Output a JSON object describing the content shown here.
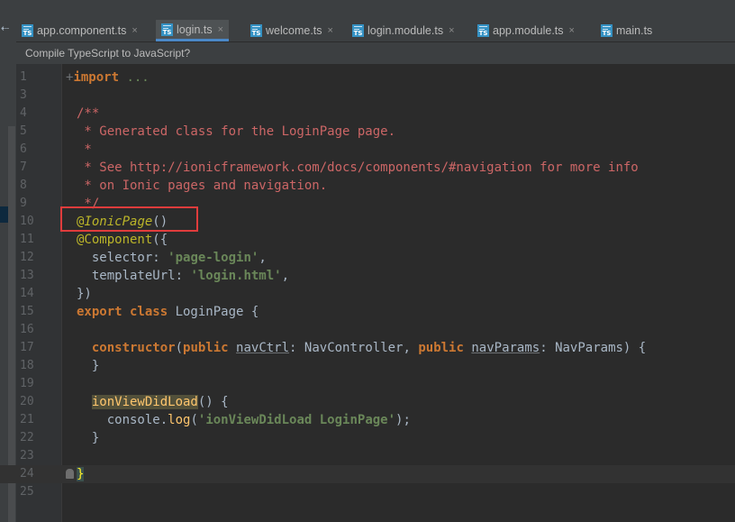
{
  "window": {
    "left_arrow": "⇠"
  },
  "tabs": [
    {
      "label": "app.component.ts",
      "active": false
    },
    {
      "label": "login.ts",
      "active": true
    },
    {
      "label": "welcome.ts",
      "active": false
    },
    {
      "label": "login.module.ts",
      "active": false
    },
    {
      "label": "app.module.ts",
      "active": false
    },
    {
      "label": "main.ts",
      "active": false
    }
  ],
  "breadcrumb": "Compile TypeScript to JavaScript?",
  "colors": {
    "editor_bg": "#2b2b2b",
    "keyword": "#cc7832",
    "string": "#6a8759",
    "comment": "#cc6666",
    "annotation": "#bbb529",
    "highlight_box": "#e03c3c"
  },
  "icons": {
    "file": "ts-file-icon",
    "close": "×"
  },
  "editor": {
    "lines": [
      {
        "n": "1",
        "segments": [
          [
            "plus",
            "+"
          ],
          [
            "kw",
            "import"
          ],
          [
            "punc",
            " "
          ],
          [
            "fold",
            "..."
          ]
        ]
      },
      {
        "n": "3",
        "segments": []
      },
      {
        "n": "4",
        "segments": [
          [
            "cm",
            "/**"
          ]
        ]
      },
      {
        "n": "5",
        "segments": [
          [
            "cm",
            " * Generated class for the LoginPage page."
          ]
        ]
      },
      {
        "n": "6",
        "segments": [
          [
            "cm",
            " *"
          ]
        ]
      },
      {
        "n": "7",
        "segments": [
          [
            "cm",
            " * See http://ionicframework.com/docs/components/#navigation for more info"
          ]
        ]
      },
      {
        "n": "8",
        "segments": [
          [
            "cm",
            " * on Ionic pages and navigation."
          ]
        ]
      },
      {
        "n": "9",
        "segments": [
          [
            "cm",
            " */"
          ]
        ]
      },
      {
        "n": "10",
        "segments": [
          [
            "ann",
            "@"
          ],
          [
            "annI",
            "IonicPage"
          ],
          [
            "punc",
            "()"
          ]
        ]
      },
      {
        "n": "11",
        "segments": [
          [
            "ann",
            "@Component"
          ],
          [
            "punc",
            "({"
          ]
        ]
      },
      {
        "n": "12",
        "segments": [
          [
            "punc",
            "  selector: "
          ],
          [
            "str",
            "'page-login'"
          ],
          [
            "punc",
            ","
          ]
        ]
      },
      {
        "n": "13",
        "segments": [
          [
            "punc",
            "  templateUrl: "
          ],
          [
            "str",
            "'login.html'"
          ],
          [
            "punc",
            ","
          ]
        ]
      },
      {
        "n": "14",
        "segments": [
          [
            "punc",
            "})"
          ]
        ]
      },
      {
        "n": "15",
        "segments": [
          [
            "kw",
            "export class "
          ],
          [
            "punc",
            "LoginPage "
          ],
          [
            "punc",
            "{"
          ]
        ]
      },
      {
        "n": "16",
        "segments": []
      },
      {
        "n": "17",
        "segments": [
          [
            "punc",
            "  "
          ],
          [
            "kw",
            "constructor"
          ],
          [
            "punc",
            "("
          ],
          [
            "kw",
            "public "
          ],
          [
            "param",
            "navCtrl"
          ],
          [
            "punc",
            ": NavController, "
          ],
          [
            "kw",
            "public "
          ],
          [
            "param",
            "navParams"
          ],
          [
            "punc",
            ": NavParams) {"
          ]
        ]
      },
      {
        "n": "18",
        "segments": [
          [
            "punc",
            "  }"
          ]
        ]
      },
      {
        "n": "19",
        "segments": []
      },
      {
        "n": "20",
        "segments": [
          [
            "punc",
            "  "
          ],
          [
            "methodhl",
            "ionViewDidLoad"
          ],
          [
            "punc",
            "() {"
          ]
        ]
      },
      {
        "n": "21",
        "segments": [
          [
            "punc",
            "    console."
          ],
          [
            "method",
            "log"
          ],
          [
            "punc",
            "("
          ],
          [
            "str",
            "'ionViewDidLoad LoginPage'"
          ],
          [
            "punc",
            ");"
          ]
        ]
      },
      {
        "n": "22",
        "segments": [
          [
            "punc",
            "  }"
          ]
        ]
      },
      {
        "n": "23",
        "segments": []
      },
      {
        "n": "24",
        "segments": [
          [
            "brace-match",
            "}"
          ]
        ]
      },
      {
        "n": "25",
        "segments": []
      }
    ]
  }
}
